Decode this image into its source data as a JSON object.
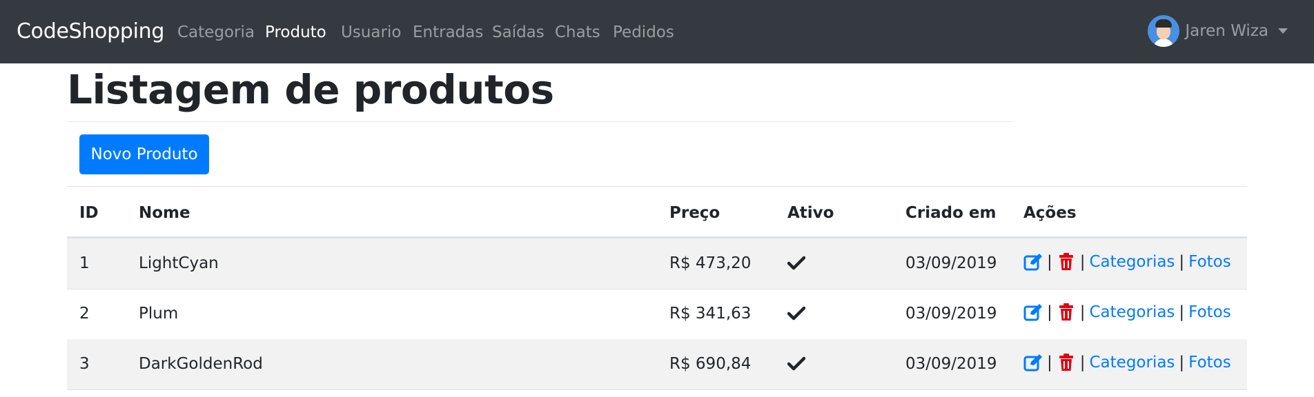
{
  "navbar": {
    "brand": "CodeShopping",
    "links": [
      {
        "label": "Categoria",
        "active": false
      },
      {
        "label": "Produto",
        "active": true
      },
      {
        "label": "Usuario",
        "active": false
      },
      {
        "label": "Entradas",
        "active": false
      },
      {
        "label": "Saídas",
        "active": false
      },
      {
        "label": "Chats",
        "active": false
      },
      {
        "label": "Pedidos",
        "active": false
      }
    ],
    "user_name": "Jaren Wiza"
  },
  "page": {
    "title": "Listagem de produtos",
    "new_button": "Novo Produto"
  },
  "table": {
    "headers": [
      "ID",
      "Nome",
      "Preço",
      "Ativo",
      "Criado em",
      "Ações"
    ],
    "rows": [
      {
        "id": "1",
        "name": "LightCyan",
        "price": "R$ 473,20",
        "active": true,
        "created": "03/09/2019"
      },
      {
        "id": "2",
        "name": "Plum",
        "price": "R$ 341,63",
        "active": true,
        "created": "03/09/2019"
      },
      {
        "id": "3",
        "name": "DarkGoldenRod",
        "price": "R$ 690,84",
        "active": true,
        "created": "03/09/2019"
      }
    ],
    "action_labels": {
      "sep": "|",
      "categories": "Categorias",
      "photos": "Fotos"
    },
    "icons": {
      "edit": "edit-icon",
      "delete": "trash-icon",
      "active": "check-icon"
    }
  },
  "colors": {
    "navbar_bg": "#343a40",
    "primary": "#007bff",
    "danger": "#e3000f",
    "stripe": "#f2f2f2"
  }
}
